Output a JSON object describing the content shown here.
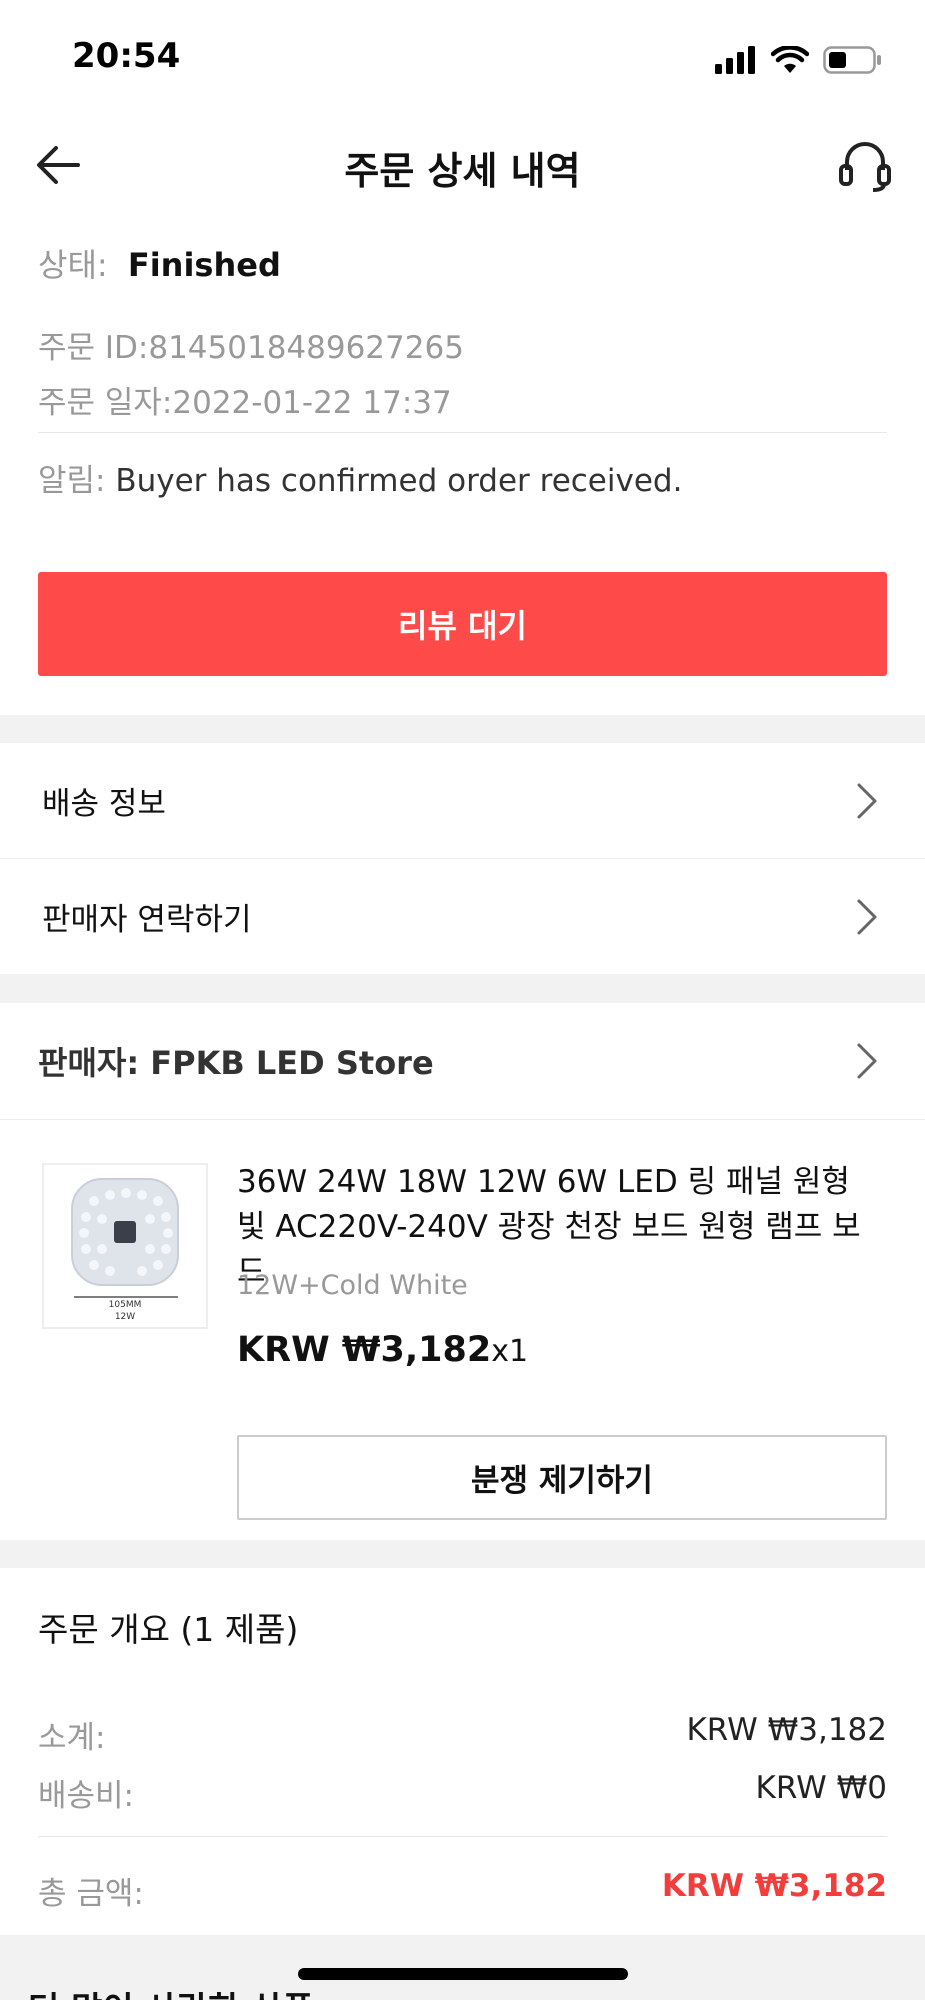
{
  "status_bar": {
    "time": "20:54",
    "signal_icon": "cellular-signal-icon",
    "wifi_icon": "wifi-icon",
    "battery_icon": "battery-icon"
  },
  "header": {
    "title": "주문 상세 내역",
    "back_icon": "back-arrow-icon",
    "support_icon": "headset-icon"
  },
  "order": {
    "status_label": "상태:",
    "status_value": "Finished",
    "id_text": "주문 ID:8145018489627265",
    "date_text": "주문 일자:2022-01-22 17:37",
    "notice_label": "알림:",
    "notice_value": "Buyer has confirmed order received."
  },
  "review_button": "리뷰 대기",
  "menu": {
    "shipping_info": "배송 정보",
    "contact_seller": "판매자 연락하기"
  },
  "seller": {
    "label": "판매자: FPKB LED Store"
  },
  "product": {
    "title": "36W 24W 18W 12W 6W LED 링 패널 원형 빛 AC220V-240V 광장 천장 보드 원형 램프 보드",
    "variant": "12W+Cold White",
    "price": "KRW ₩3,182",
    "quantity": "x1",
    "thumb_caption_1": "105MM",
    "thumb_caption_2": "12W"
  },
  "dispute_button": "분쟁 제기하기",
  "summary": {
    "title": "주문 개요 (1 제품)",
    "subtotal_label": "소계:",
    "subtotal_value": "KRW ₩3,182",
    "shipping_label": "배송비:",
    "shipping_value": "KRW ₩0",
    "total_label": "총 금액:",
    "total_value": "KRW ₩3,182"
  },
  "more_section": {
    "title": "더 많이 사랑한 상품"
  },
  "colors": {
    "accent": "#fe4a49",
    "total_red": "#f23d3a",
    "section_bg": "#f2f2f2"
  }
}
